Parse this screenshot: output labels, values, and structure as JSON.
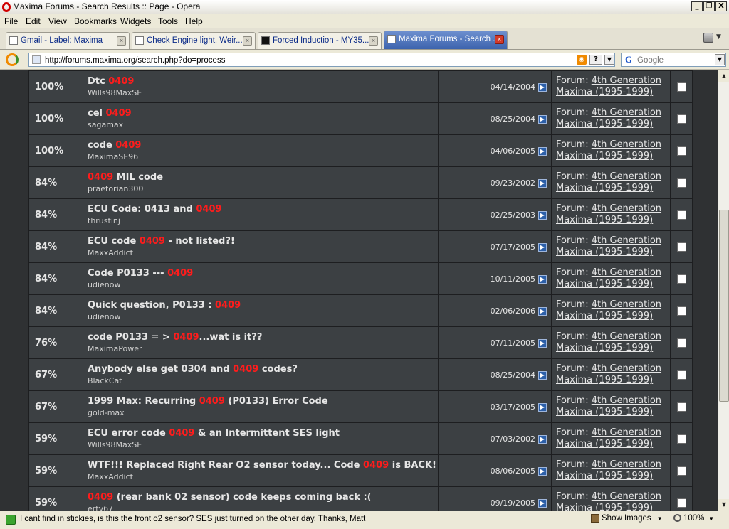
{
  "window": {
    "title": "Maxima Forums - Search Results :: Page - Opera",
    "minimize_label": "_",
    "restore_label": "❐",
    "close_label": "X"
  },
  "menu": [
    "File",
    "Edit",
    "View",
    "Bookmarks",
    "Widgets",
    "Tools",
    "Help"
  ],
  "tabs": [
    {
      "label": "Gmail - Label: Maxima",
      "active": false
    },
    {
      "label": "Check Engine light, Weir...",
      "active": false
    },
    {
      "label": "Forced Induction - MY35...",
      "active": false
    },
    {
      "label": "Maxima Forums - Search ...",
      "active": true
    }
  ],
  "address": {
    "url": "http://forums.maxima.org/search.php?do=process",
    "search_placeholder": "Google"
  },
  "forum_prefix": "Forum:",
  "forum_name_line1": "4th Generation",
  "forum_name_line2": "Maxima (1995-1999)",
  "results": [
    {
      "relevance": "100%",
      "title_pre": "Dtc ",
      "hl": "0409",
      "title_post": "",
      "author": "Wills98MaxSE",
      "date": "04/14/2004"
    },
    {
      "relevance": "100%",
      "title_pre": "cel ",
      "hl": "0409",
      "title_post": "",
      "author": "sagamax",
      "date": "08/25/2004"
    },
    {
      "relevance": "100%",
      "title_pre": "code ",
      "hl": "0409",
      "title_post": "",
      "author": "MaximaSE96",
      "date": "04/06/2005"
    },
    {
      "relevance": "84%",
      "title_pre": "",
      "hl": "0409",
      "title_post": " MIL code",
      "author": "praetorian300",
      "date": "09/23/2002"
    },
    {
      "relevance": "84%",
      "title_pre": "ECU Code: 0413 and ",
      "hl": "0409",
      "title_post": "",
      "author": "thrustinj",
      "date": "02/25/2003"
    },
    {
      "relevance": "84%",
      "title_pre": "ECU code ",
      "hl": "0409",
      "title_post": " - not listed?!",
      "author": "MaxxAddict",
      "date": "07/17/2005"
    },
    {
      "relevance": "84%",
      "title_pre": "Code P0133 --- ",
      "hl": "0409",
      "title_post": "",
      "author": "udienow",
      "date": "10/11/2005"
    },
    {
      "relevance": "84%",
      "title_pre": "Quick question, P0133 : ",
      "hl": "0409",
      "title_post": "",
      "author": "udienow",
      "date": "02/06/2006"
    },
    {
      "relevance": "76%",
      "title_pre": "code P0133 = > ",
      "hl": "0409",
      "title_post": "...wat is it??",
      "author": "MaximaPower",
      "date": "07/11/2005"
    },
    {
      "relevance": "67%",
      "title_pre": "Anybody else get 0304 and ",
      "hl": "0409",
      "title_post": " codes?",
      "author": "BlackCat",
      "date": "08/25/2004"
    },
    {
      "relevance": "67%",
      "title_pre": "1999 Max: Recurring ",
      "hl": "0409",
      "title_post": " (P0133) Error Code",
      "author": "gold-max",
      "date": "03/17/2005"
    },
    {
      "relevance": "59%",
      "title_pre": "ECU error code ",
      "hl": "0409",
      "title_post": " & an Intermittent SES light",
      "author": "Wills98MaxSE",
      "date": "07/03/2002"
    },
    {
      "relevance": "59%",
      "title_pre": "WTF!!! Replaced Right Rear O2 sensor today... Code ",
      "hl": "0409",
      "title_post": " is BACK!",
      "author": "MaxxAddict",
      "date": "08/06/2005"
    },
    {
      "relevance": "59%",
      "title_pre": "",
      "hl": "0409",
      "title_post": " (rear bank 02 sensor) code keeps coming back :(",
      "author": "ertv67",
      "date": "09/19/2005"
    }
  ],
  "status": {
    "text": "I cant find in stickies, is this the front o2 sensor? SES just turned on the other day. Thanks, Matt",
    "show_images": "Show Images",
    "zoom": "100%"
  }
}
